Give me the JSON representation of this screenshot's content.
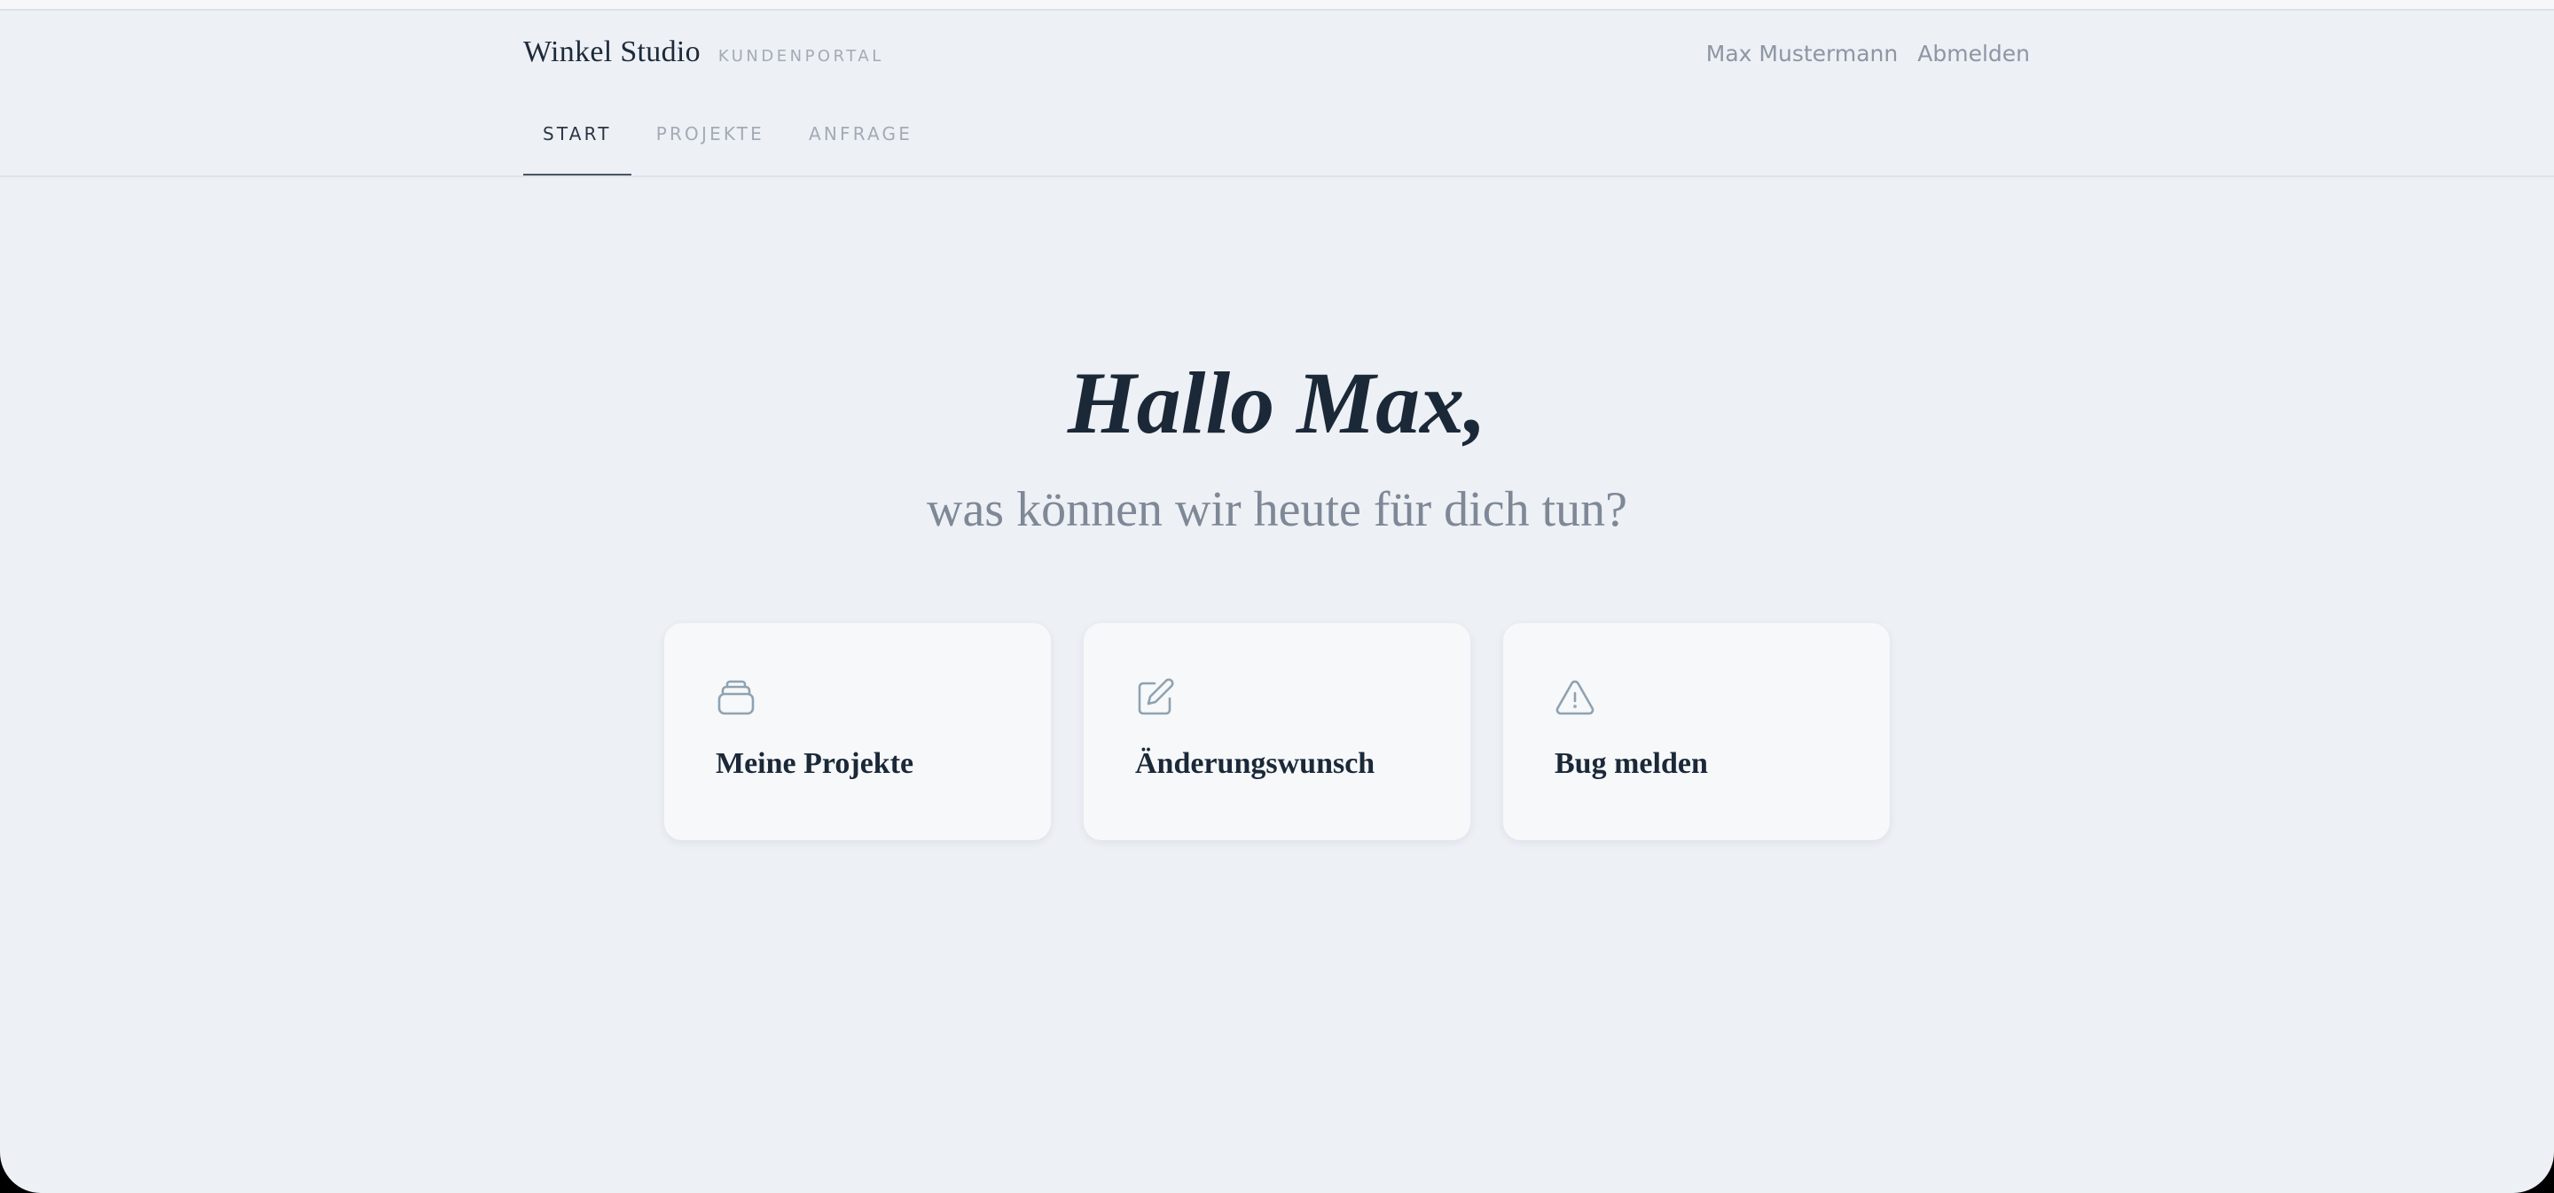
{
  "header": {
    "brand_name": "Winkel Studio",
    "brand_sub": "KUNDENPORTAL",
    "user_name": "Max Mustermann",
    "logout_label": "Abmelden"
  },
  "tabs": [
    {
      "label": "START",
      "active": true
    },
    {
      "label": "PROJEKTE",
      "active": false
    },
    {
      "label": "ANFRAGE",
      "active": false
    }
  ],
  "hero": {
    "title": "Hallo Max,",
    "subtitle": "was können wir heute für dich tun?"
  },
  "cards": [
    {
      "label": "Meine Projekte",
      "icon": "stack-icon"
    },
    {
      "label": "Änderungswunsch",
      "icon": "edit-icon"
    },
    {
      "label": "Bug melden",
      "icon": "warning-icon"
    }
  ],
  "colors": {
    "background": "#edf0f5",
    "card_background": "#f6f8fa",
    "text_primary": "#1b2838",
    "text_muted": "#7e8896",
    "icon": "#8fa2b1"
  }
}
